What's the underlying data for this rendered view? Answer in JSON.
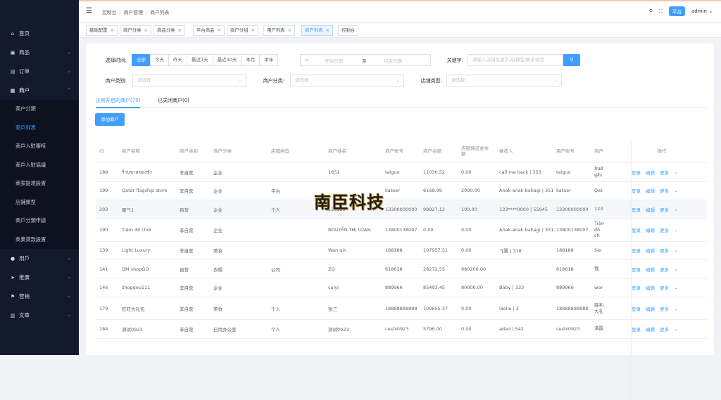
{
  "sidebar": {
    "items": [
      {
        "icon": "⌂",
        "label": "首页",
        "arrow": ""
      },
      {
        "icon": "▣",
        "label": "商品",
        "arrow": "⌄"
      },
      {
        "icon": "▤",
        "label": "订单",
        "arrow": "⌄"
      },
      {
        "icon": "▦",
        "label": "商户",
        "arrow": "⌃"
      }
    ],
    "submenu": [
      "商户分類",
      "商戶列表",
      "商戶入駐審核",
      "商戶入駐協議",
      "商家提現設置",
      "店鋪類型",
      "商戶分類申請",
      "商業貸款設置"
    ],
    "active_sub": 1,
    "bottom_items": [
      {
        "icon": "●",
        "label": "用戶",
        "arrow": "⌄"
      },
      {
        "icon": "➤",
        "label": "推廣",
        "arrow": "⌄"
      },
      {
        "icon": "⚑",
        "label": "营销",
        "arrow": "⌄"
      },
      {
        "icon": "▥",
        "label": "文章",
        "arrow": "⌄"
      }
    ]
  },
  "topbar": {
    "breadcrumb": [
      "控制台",
      "商户管理",
      "商户列表"
    ],
    "platform": "平台",
    "user": "admin"
  },
  "tags": [
    {
      "label": "基础配置",
      "closable": true,
      "active": false
    },
    {
      "label": "商户分类",
      "closable": true,
      "active": false
    },
    {
      "label": "商品分类",
      "closable": true,
      "active": false
    },
    {
      "label": "平台商品",
      "closable": true,
      "active": false
    },
    {
      "label": "商户分组",
      "closable": true,
      "active": false
    },
    {
      "label": "用户列表",
      "closable": true,
      "active": false
    },
    {
      "label": "商户列表",
      "closable": true,
      "active": true
    },
    {
      "label": "控制台",
      "closable": false,
      "active": false
    }
  ],
  "filters": {
    "time_label": "选择时间:",
    "time_options": [
      "全部",
      "今天",
      "昨天",
      "最近7天",
      "最近30天",
      "本月",
      "本年"
    ],
    "time_active": 0,
    "date_start": "开始日期",
    "date_sep": "至",
    "date_end": "结束日期",
    "keyword_label": "关键字:",
    "keyword_placeholder": "请输入店铺关键字/店铺名/联系电话",
    "merchant_type_label": "商户类别:",
    "merchant_category_label": "商户分类:",
    "store_type_label": "店铺类型:",
    "select_placeholder": "请选择"
  },
  "tabs": {
    "open": "正常开启的商户(75)",
    "closed": "已关闭商户(0)"
  },
  "add_button": "添加商户",
  "table": {
    "headers": [
      "ID",
      "商户名称",
      "商户类别",
      "商户分类",
      "店铺类型",
      "商户姓名",
      "商户账号",
      "商户余额",
      "店铺保证金余额",
      "推荐人",
      "用户账号",
      "商户",
      "操作"
    ],
    "rows": [
      [
        "188",
        "ร้านขายของชำ",
        "非自营",
        "企业",
        "",
        "1651",
        "taiguo",
        "11030.52",
        "0.00",
        "call me back | 353",
        "taiguo",
        "ลินด์ ฝูลัง"
      ],
      [
        "199",
        "Qatar flagship store",
        "非自营",
        "企业",
        "平台",
        "",
        "kataer",
        "6168.99",
        "2000.00",
        "Anak-anak bahagi | 351",
        "kataer",
        "Qat"
      ],
      [
        "203",
        "服气1",
        "自营",
        "企业",
        "个人",
        "123123",
        "13300000000",
        "99927.12",
        "100.00",
        "133****0000 | 55945",
        "13300000000",
        "123"
      ],
      [
        "190",
        "Tiệm đồ chơi",
        "非自营",
        "企业",
        "",
        "NGUYỄN THỊ LOAN",
        "13800138007",
        "0.00",
        "0.00",
        "Anak-anak bahagi | 351",
        "13800138007",
        "Tiệm đồ ch"
      ],
      [
        "139",
        "Light Luxury",
        "非自营",
        "美妆",
        "",
        "Wan qin",
        "188188",
        "107957.51",
        "0.00",
        "飞翼 | 318",
        "188188",
        "Ser"
      ],
      [
        "141",
        "DM shopGO",
        "自营",
        "衣帽",
        "公司",
        "ZQ",
        "618618",
        "28272.55",
        "980200.00",
        "",
        "618618",
        "我"
      ],
      [
        "146",
        "shopgou111",
        "非自营",
        "企业",
        "",
        "caiyi",
        "889966",
        "85493.45",
        "80000.00",
        "Baby | 333",
        "889966",
        "wor"
      ],
      [
        "179",
        "旺旺大礼包",
        "非自营",
        "美妆",
        "个人",
        "张三",
        "18888888888",
        "100655.37",
        "0.00",
        "laolie | 3",
        "18888888888",
        "胜利大礼"
      ],
      [
        "184",
        "测试0923",
        "非自营",
        "日用办公室",
        "个人",
        "测试0923",
        "ceshi0923",
        "5796.00",
        "0.00",
        "adad | 542",
        "ceshi0923",
        "满霞"
      ]
    ],
    "ops": [
      "登录",
      "编辑",
      "更多"
    ]
  },
  "watermark": "南臣科技"
}
